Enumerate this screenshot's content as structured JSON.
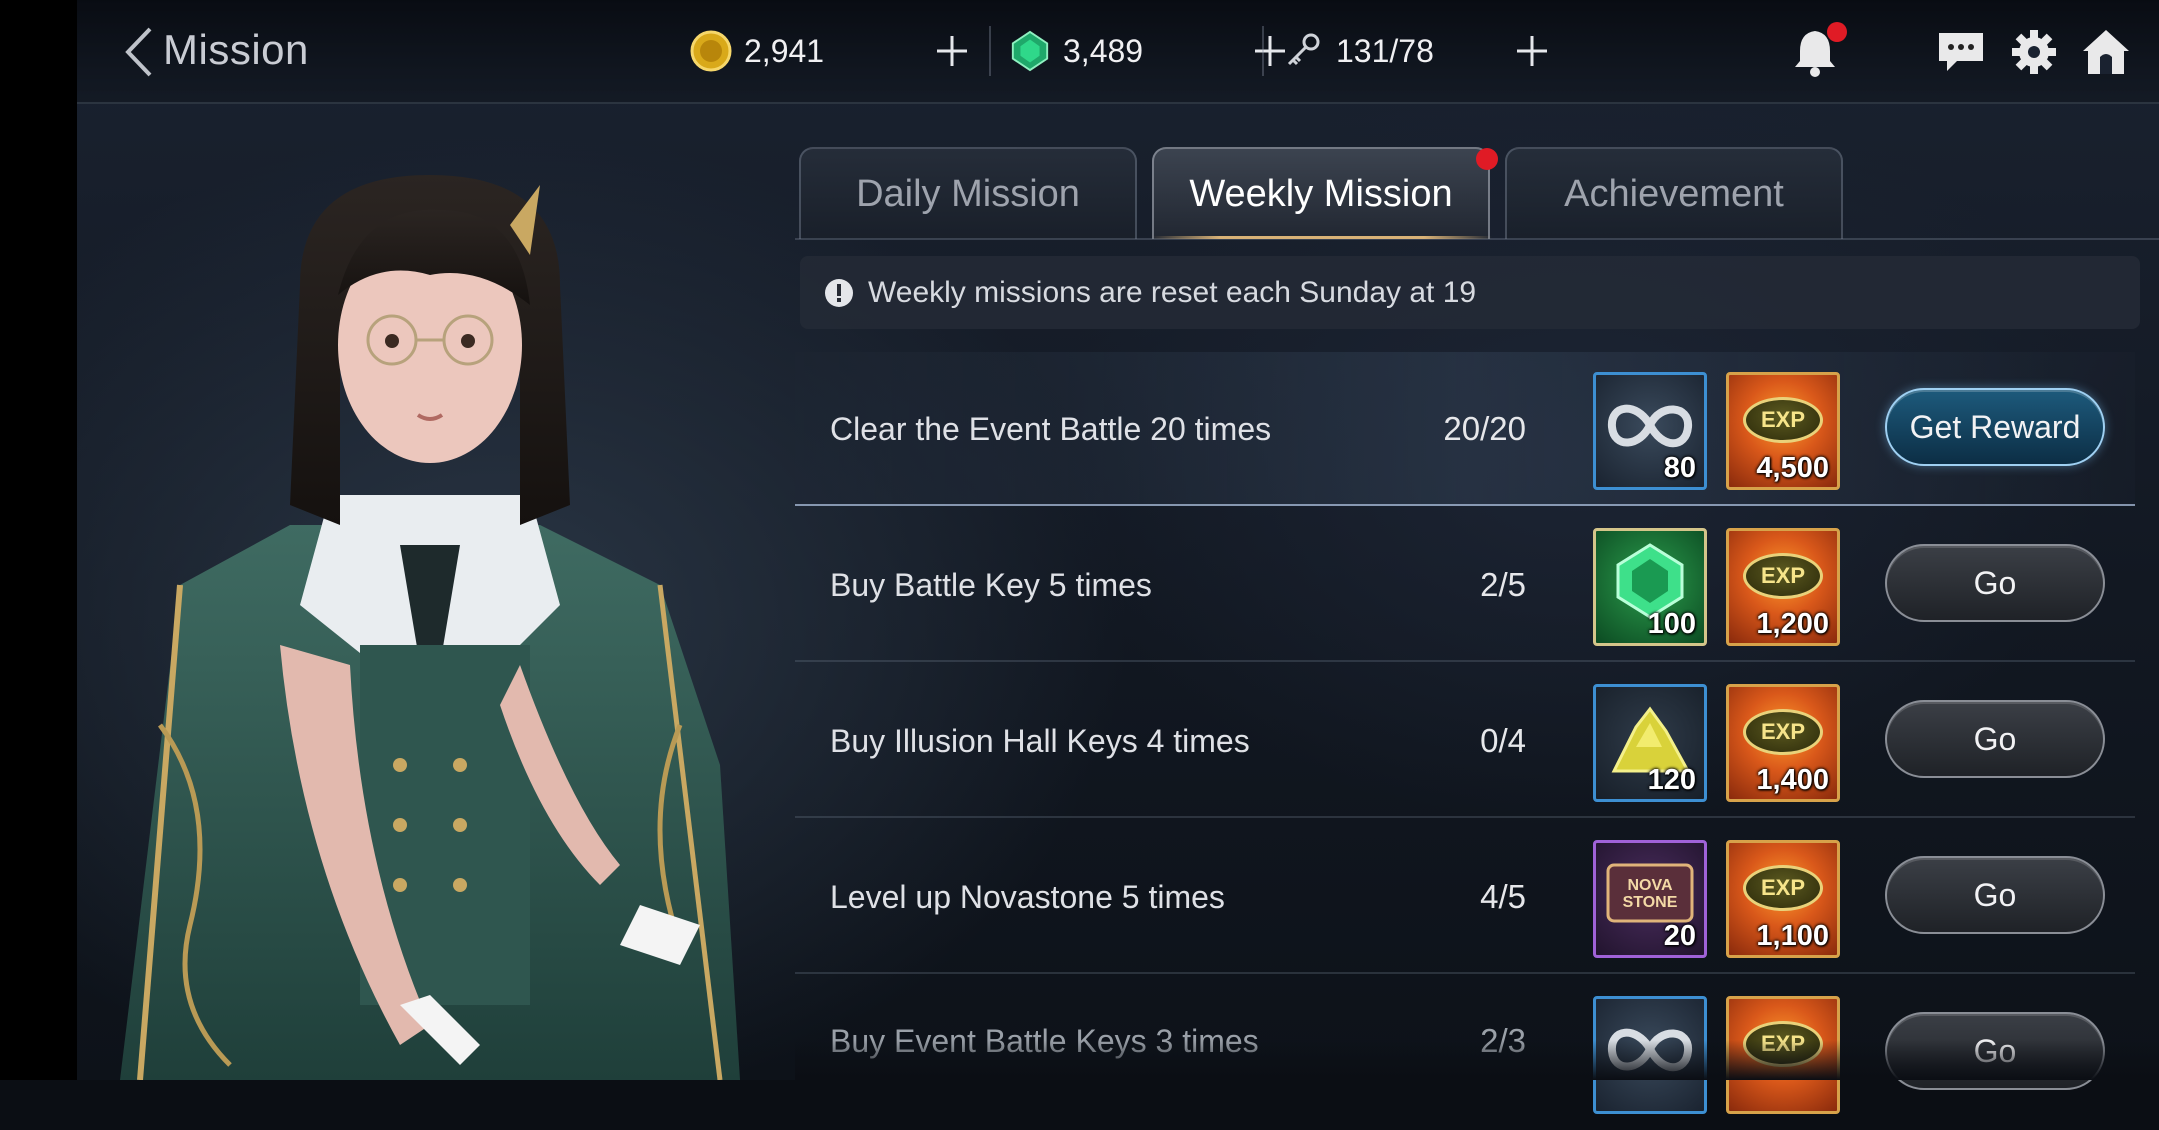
{
  "header": {
    "title": "Mission",
    "gold": "2,941",
    "gems": "3,489",
    "stamina": "131/78"
  },
  "tabs": [
    {
      "label": "Daily Mission"
    },
    {
      "label": "Weekly Mission"
    },
    {
      "label": "Achievement"
    }
  ],
  "notice": "Weekly missions are reset each Sunday at 19",
  "missions": [
    {
      "label": "Clear the Event Battle 20 times",
      "progress": "20/20",
      "reward1_icon": "infinity-ring-icon",
      "reward1_qty": "80",
      "exp_label": "EXP",
      "exp_qty": "4,500",
      "button": "Get Reward"
    },
    {
      "label": "Buy Battle Key 5 times",
      "progress": "2/5",
      "reward1_icon": "green-gem-icon",
      "reward1_qty": "100",
      "exp_label": "EXP",
      "exp_qty": "1,200",
      "button": "Go"
    },
    {
      "label": "Buy Illusion Hall Keys 4 times",
      "progress": "0/4",
      "reward1_icon": "gold-ore-icon",
      "reward1_qty": "120",
      "exp_label": "EXP",
      "exp_qty": "1,400",
      "button": "Go"
    },
    {
      "label": "Level up Novastone 5 times",
      "progress": "4/5",
      "reward1_icon": "nova-stone-ticket-icon",
      "reward1_text": "NOVA STONE",
      "reward1_qty": "20",
      "exp_label": "EXP",
      "exp_qty": "1,100",
      "button": "Go"
    },
    {
      "label": "Buy Event Battle Keys 3 times",
      "progress": "2/3",
      "reward1_icon": "infinity-ring-icon",
      "reward1_qty": "",
      "exp_label": "EXP",
      "exp_qty": "",
      "button": "Go"
    }
  ],
  "colors": {
    "notification": "#e01b25",
    "tab_accent": "#d9b277",
    "reward_button": "#1d5a7c"
  }
}
